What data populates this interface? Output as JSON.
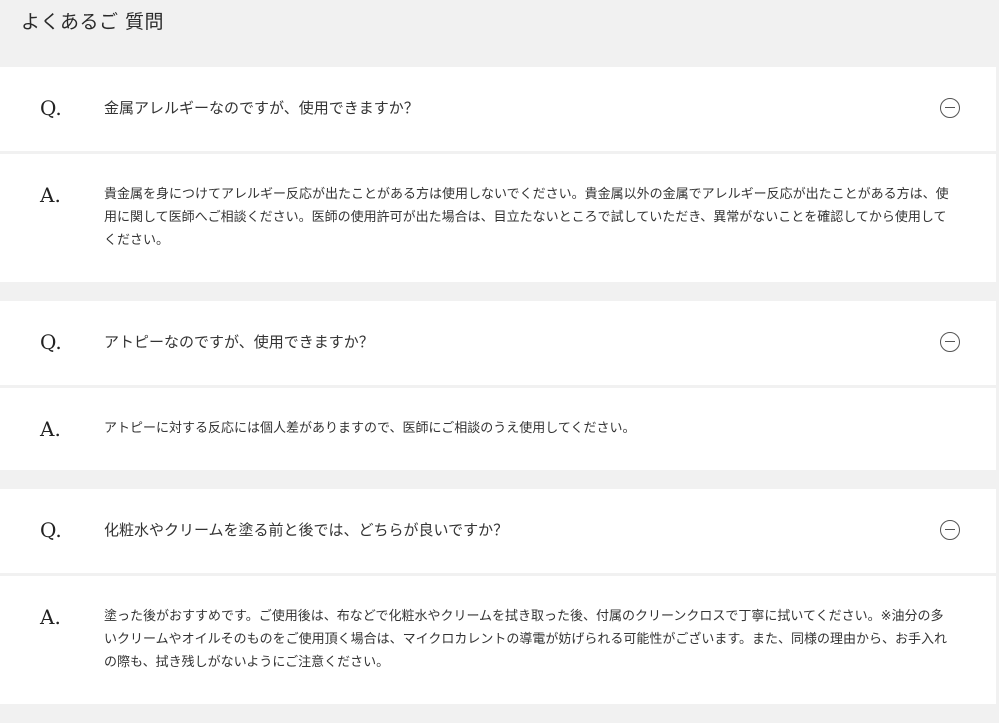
{
  "page": {
    "title": "よくあるご 質問"
  },
  "faq": [
    {
      "q_marker": "Q.",
      "question": "金属アレルギーなのですが、使用できますか？",
      "a_marker": "A.",
      "answer": "貴金属を身につけてアレルギー反応が出たことがある方は使用しないでください。貴金属以外の金属でアレルギー反応が出たことがある方は、使用に関して医師へご相談ください。医師の使用許可が出た場合は、目立たないところで試していただき、異常がないことを確認してから使用してください。",
      "toggle_icon": "minus-circle-icon"
    },
    {
      "q_marker": "Q.",
      "question": "アトピーなのですが、使用できますか？",
      "a_marker": "A.",
      "answer": "アトピーに対する反応には個人差がありますので、医師にご相談のうえ使用してください。",
      "toggle_icon": "minus-circle-icon"
    },
    {
      "q_marker": "Q.",
      "question": "化粧水やクリームを塗る前と後では、どちらが良いですか？",
      "a_marker": "A.",
      "answer": "塗った後がおすすめです。ご使用後は、布などで化粧水やクリームを拭き取った後、付属のクリーンクロスで丁寧に拭いてください。※油分の多いクリームやオイルそのものをご使用頂く場合は、マイクロカレントの導電が妨げられる可能性がございます。また、同様の理由から、お手入れの際も、拭き残しがないようにご注意ください。",
      "toggle_icon": "minus-circle-icon"
    }
  ],
  "colors": {
    "background": "#f1f1f1",
    "card": "#ffffff",
    "text": "#333333"
  }
}
